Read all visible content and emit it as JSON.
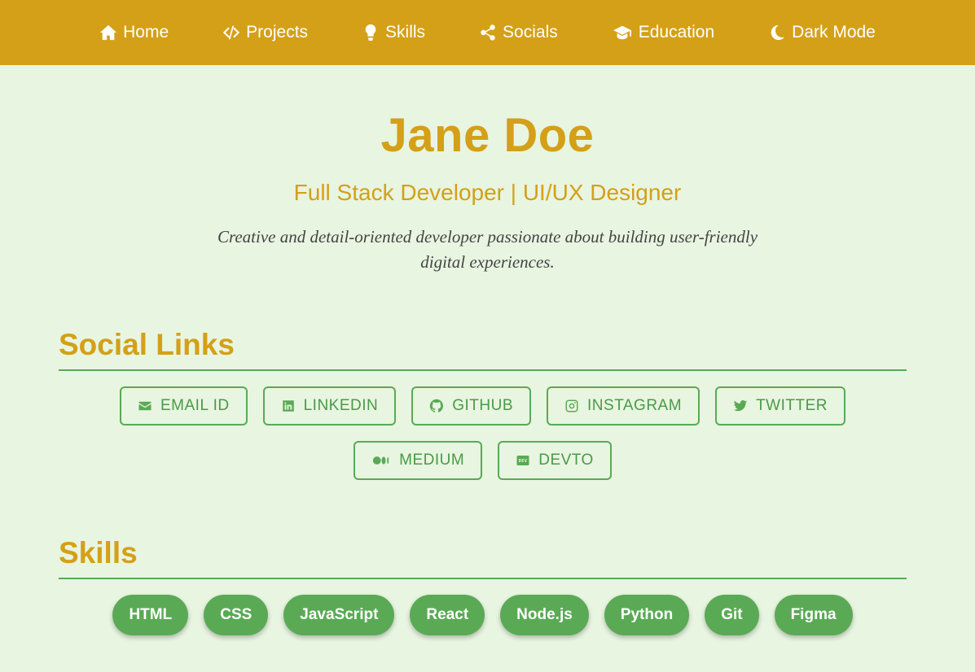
{
  "nav": {
    "items": [
      {
        "label": "Home",
        "icon": "home-icon"
      },
      {
        "label": "Projects",
        "icon": "code-icon"
      },
      {
        "label": "Skills",
        "icon": "lightbulb-icon"
      },
      {
        "label": "Socials",
        "icon": "share-icon"
      },
      {
        "label": "Education",
        "icon": "graduation-cap-icon"
      },
      {
        "label": "Dark Mode",
        "icon": "moon-icon"
      }
    ]
  },
  "hero": {
    "name": "Jane Doe",
    "title": "Full Stack Developer | UI/UX Designer",
    "description": "Creative and detail-oriented developer passionate about building user-friendly digital experiences."
  },
  "social": {
    "heading": "Social Links",
    "links": [
      {
        "label": "EMAIL ID",
        "icon": "envelope-icon"
      },
      {
        "label": "LINKEDIN",
        "icon": "linkedin-icon"
      },
      {
        "label": "GITHUB",
        "icon": "github-icon"
      },
      {
        "label": "INSTAGRAM",
        "icon": "instagram-icon"
      },
      {
        "label": "TWITTER",
        "icon": "twitter-icon"
      },
      {
        "label": "MEDIUM",
        "icon": "medium-icon"
      },
      {
        "label": "DEVTO",
        "icon": "devto-icon"
      }
    ]
  },
  "skills": {
    "heading": "Skills",
    "items": [
      "HTML",
      "CSS",
      "JavaScript",
      "React",
      "Node.js",
      "Python",
      "Git",
      "Figma"
    ]
  },
  "colors": {
    "accent": "#d4a017",
    "green": "#5aaa55",
    "background": "#e8f5e1"
  }
}
